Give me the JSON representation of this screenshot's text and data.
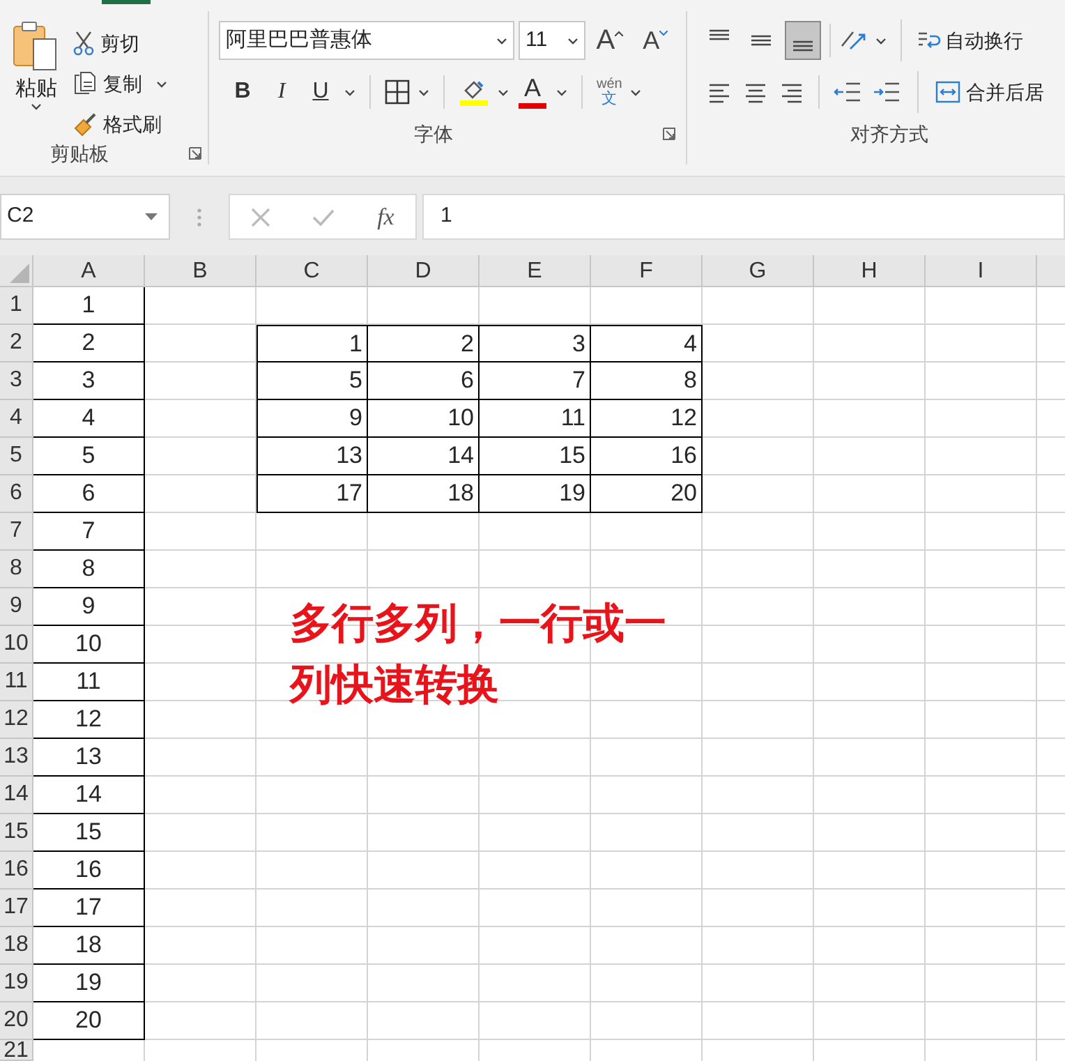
{
  "clipboard": {
    "label": "剪贴板",
    "paste": "粘贴",
    "cut": "剪切",
    "copy": "复制",
    "format_painter": "格式刷"
  },
  "font": {
    "label": "字体",
    "font_name": "阿里巴巴普惠体",
    "font_size": "11",
    "grow": "A",
    "shrink": "A",
    "bold": "B",
    "italic": "I",
    "underline": "U",
    "font_color": "A",
    "phonetic_top": "wén",
    "phonetic_bottom": "文"
  },
  "alignment": {
    "label": "对齐方式",
    "vertical_align": [
      {
        "kind": "top",
        "selected": false
      },
      {
        "kind": "middle",
        "selected": false
      },
      {
        "kind": "bottom",
        "selected": true
      }
    ],
    "wrap_text": "自动换行",
    "merge_center": "合并后居"
  },
  "formula_bar": {
    "name_box": "C2",
    "function_label": "fx",
    "value": "1"
  },
  "sheet": {
    "columns": [
      "A",
      "B",
      "C",
      "D",
      "E",
      "F",
      "G",
      "H",
      "I"
    ],
    "row_headers": [
      "1",
      "2",
      "3",
      "4",
      "5",
      "6",
      "7",
      "8",
      "9",
      "10",
      "11",
      "12",
      "13",
      "14",
      "15",
      "16",
      "17",
      "18",
      "19",
      "20",
      "21"
    ],
    "column_a": [
      "1",
      "2",
      "3",
      "4",
      "5",
      "6",
      "7",
      "8",
      "9",
      "10",
      "11",
      "12",
      "13",
      "14",
      "15",
      "16",
      "17",
      "18",
      "19",
      "20"
    ],
    "block": [
      [
        "1",
        "2",
        "3",
        "4"
      ],
      [
        "5",
        "6",
        "7",
        "8"
      ],
      [
        "9",
        "10",
        "11",
        "12"
      ],
      [
        "13",
        "14",
        "15",
        "16"
      ],
      [
        "17",
        "18",
        "19",
        "20"
      ]
    ],
    "note": "多行多列，一行或一列快速转换"
  }
}
